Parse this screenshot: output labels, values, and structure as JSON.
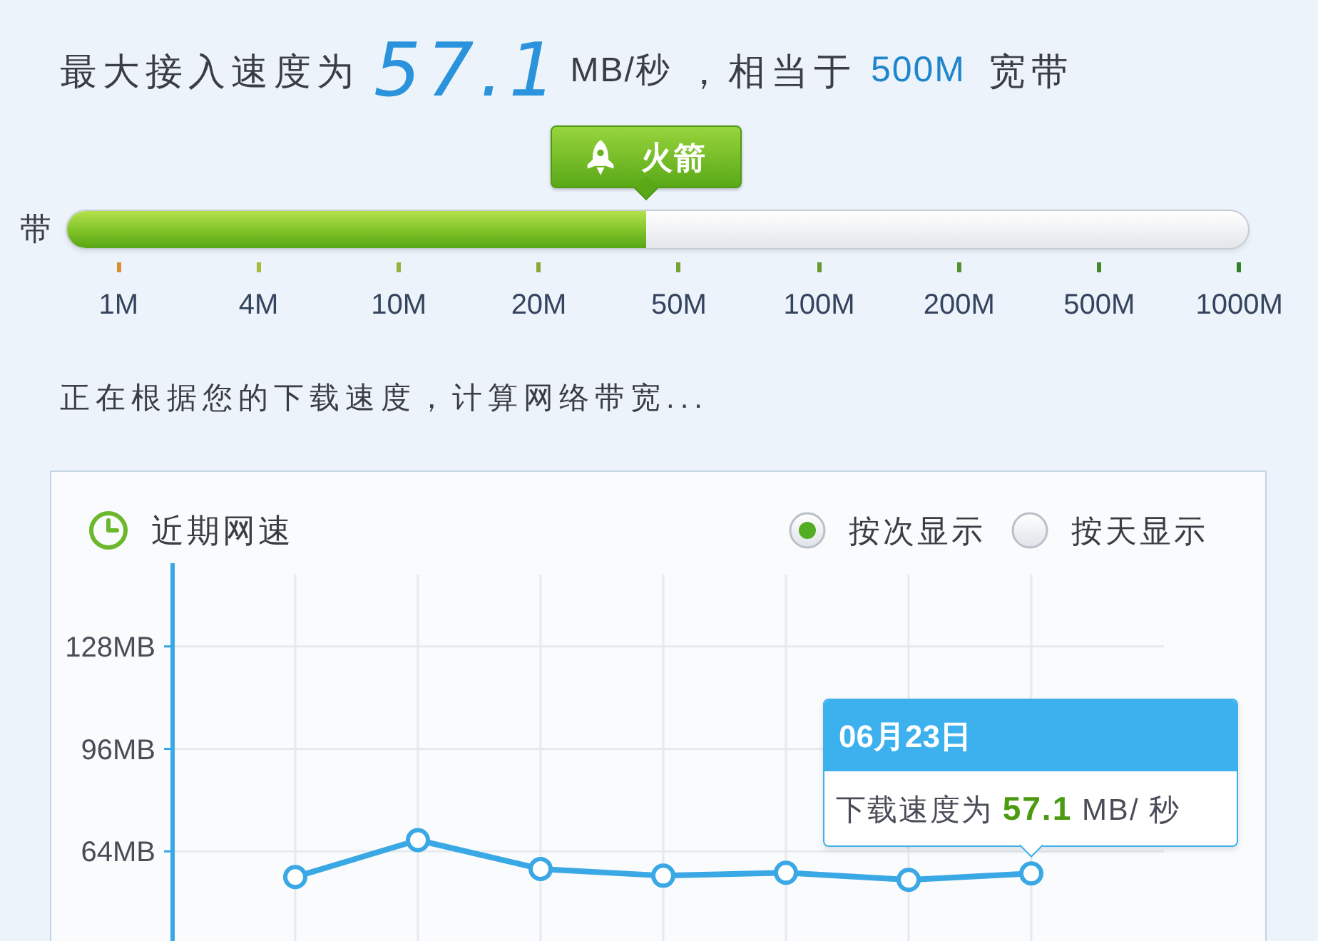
{
  "headline": {
    "prefix": "最大接入速度为",
    "speed": "57.1",
    "unit": "MB/秒",
    "middle": "，相当于",
    "bandwidth": "500M",
    "suffix": "宽带"
  },
  "speed_bar": {
    "badge": "火箭",
    "label": "带",
    "level": 0.49,
    "scale": [
      "1M",
      "4M",
      "10M",
      "20M",
      "50M",
      "100M",
      "200M",
      "500M",
      "1000M"
    ]
  },
  "status_text": "正在根据您的下载速度，计算网络带宽...",
  "chart_panel": {
    "title": "近期网速",
    "view_options": [
      {
        "label": "按次显示",
        "selected": true
      },
      {
        "label": "按天显示",
        "selected": false
      }
    ],
    "chart_data": {
      "type": "line",
      "grid": true,
      "marker": true,
      "ylim": [
        36,
        154
      ],
      "yticks": [
        {
          "value": 64,
          "label": "64MB"
        },
        {
          "value": 96,
          "label": "96MB"
        },
        {
          "value": 128,
          "label": "128MB"
        }
      ],
      "values": [
        56,
        67.5,
        58.5,
        56.4,
        57.3,
        55.1,
        57.1
      ]
    },
    "tooltip": {
      "date": "06月23日",
      "text": "下载速度为 **57.1** MB/ 秒"
    }
  }
}
